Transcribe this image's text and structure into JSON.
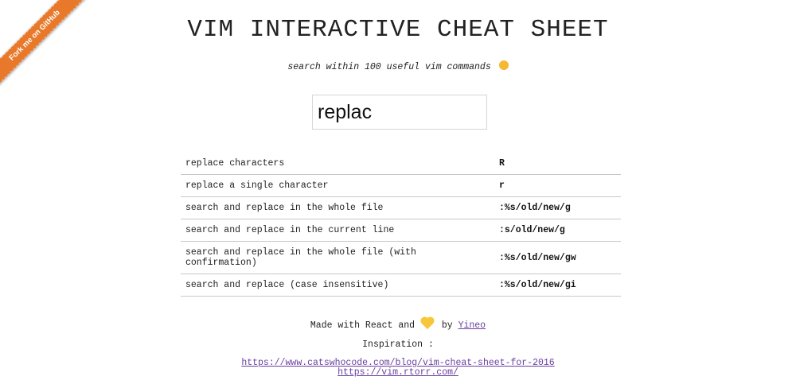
{
  "ribbon": {
    "label": "Fork me on GitHub"
  },
  "header": {
    "title": "VIM INTERACTIVE CHEAT SHEET",
    "subtitle": "search within 100 useful vim commands",
    "subtitle_emoji": "hugging-face-emoji"
  },
  "search": {
    "value": "replac",
    "placeholder": ""
  },
  "commands": [
    {
      "description": "replace characters",
      "key": "R"
    },
    {
      "description": "replace a single character",
      "key": "r"
    },
    {
      "description": "search and replace in the whole file",
      "key": ":%s/old/new/g"
    },
    {
      "description": "search and replace in the current line",
      "key": ":s/old/new/g"
    },
    {
      "description": "search and replace in the whole file (with confirmation)",
      "key": ":%s/old/new/gw"
    },
    {
      "description": "search and replace (case insensitive)",
      "key": ":%s/old/new/gi"
    }
  ],
  "footer": {
    "made_with": "Made with React and",
    "by": "by",
    "author": "Yineo",
    "inspiration_label": "Inspiration :",
    "links": [
      "https://www.catswhocode.com/blog/vim-cheat-sheet-for-2016",
      "https://vim.rtorr.com/"
    ]
  },
  "colors": {
    "ribbon": "#e8792b",
    "link": "#6a3fa0",
    "heart": "#f6c73a",
    "row_border": "#c8c8c8"
  }
}
